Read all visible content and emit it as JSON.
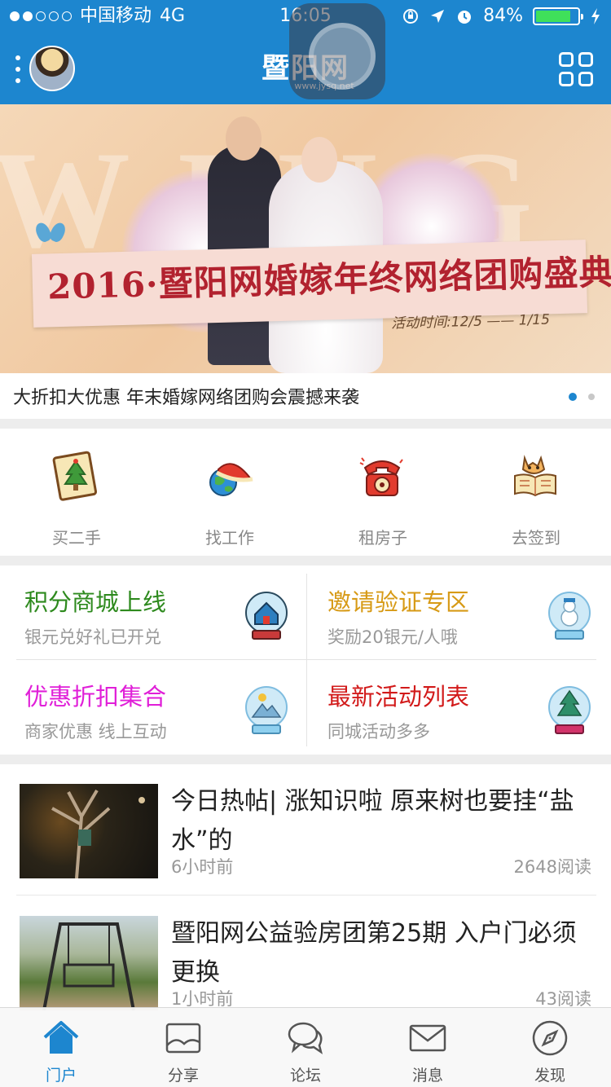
{
  "status_bar": {
    "carrier": "中国移动",
    "network": "4G",
    "time": "16:05",
    "battery": "84%",
    "battery_level": 0.84,
    "signal_bars": 2
  },
  "header": {
    "logo_name": "暨阳网",
    "logo_url": "www.jysq.net"
  },
  "banner": {
    "title": "2016·暨阳网婚嫁年终网络团购盛典",
    "date": "活动时间:12/5 —— 1/15",
    "caption": "大折扣大优惠 年末婚嫁网络团购会震撼来袭",
    "page_count": 2,
    "active_page": 1
  },
  "quick_links": [
    {
      "label": "买二手",
      "icon": "secondhand-tree-card-icon"
    },
    {
      "label": "找工作",
      "icon": "globe-hat-icon"
    },
    {
      "label": "租房子",
      "icon": "telephone-icon"
    },
    {
      "label": "去签到",
      "icon": "cat-book-icon"
    }
  ],
  "promos": [
    {
      "title": "积分商城上线",
      "subtitle": "银元兑好礼已开兑",
      "color": "#2e8a1e",
      "icon": "snowglobe-house-icon"
    },
    {
      "title": "邀请验证专区",
      "subtitle": "奖励20银元/人哦",
      "color": "#d79a16",
      "icon": "snowglobe-snowman-icon"
    },
    {
      "title": "优惠折扣集合",
      "subtitle": "商家优惠 线上互动",
      "color": "#e01fd8",
      "icon": "snowglobe-mountain-icon"
    },
    {
      "title": "最新活动列表",
      "subtitle": "同城活动多多",
      "color": "#d21a1a",
      "icon": "snowglobe-tree-icon"
    }
  ],
  "news": [
    {
      "title": "今日热帖| 涨知识啦 原来树也要挂“盐水”的",
      "time": "6小时前",
      "reads": "2648阅读"
    },
    {
      "title": "暨阳网公益验房团第25期 入户门必须更换",
      "time": "1小时前",
      "reads": "43阅读"
    }
  ],
  "tabs": [
    {
      "label": "门户",
      "icon": "home-icon",
      "active": true
    },
    {
      "label": "分享",
      "icon": "picture-icon",
      "active": false
    },
    {
      "label": "论坛",
      "icon": "chat-bubbles-icon",
      "active": false
    },
    {
      "label": "消息",
      "icon": "envelope-icon",
      "active": false
    },
    {
      "label": "发现",
      "icon": "compass-icon",
      "active": false
    }
  ],
  "colors": {
    "brand_blue": "#1d86cf",
    "battery_green": "#3fe05a",
    "banner_title_red": "#b2222f"
  }
}
